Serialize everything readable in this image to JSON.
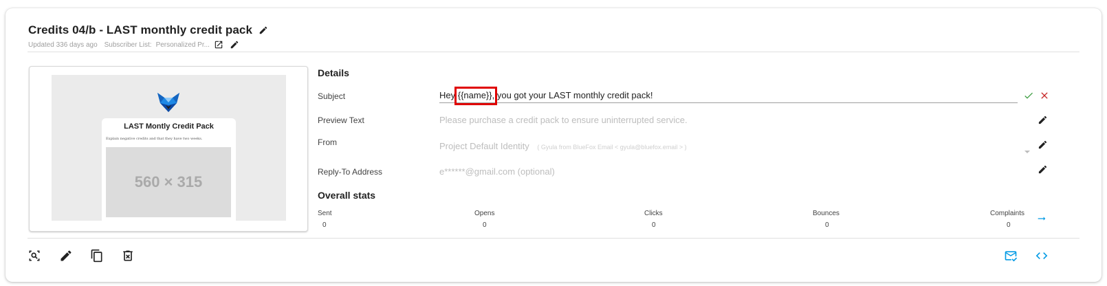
{
  "campaign": {
    "title": "Credits 04/b - LAST monthly credit pack",
    "updated": "Updated 336 days ago",
    "subscriber_list_label": "Subscriber List:",
    "subscriber_list_value": "Personalized Pr..."
  },
  "preview": {
    "heading": "LAST Montly Credit Pack",
    "body_text": "Explain negative credits and that they have two weeks.",
    "image_placeholder": "560 × 315"
  },
  "details": {
    "heading": "Details",
    "subject_label": "Subject",
    "subject_value": "Hey {{name}}, you got your LAST monthly credit pack!",
    "preview_text_label": "Preview Text",
    "preview_text_placeholder": "Please purchase a credit pack to ensure uninterrupted service.",
    "from_label": "From",
    "from_value": "Project Default Identity",
    "from_detail": "( Gyula from BlueFox Email < gyula@bluefox.email > )",
    "reply_to_label": "Reply-To Address",
    "reply_to_placeholder": "e******@gmail.com (optional)"
  },
  "stats": {
    "heading": "Overall stats",
    "items": [
      {
        "label": "Sent",
        "value": "0"
      },
      {
        "label": "Opens",
        "value": "0"
      },
      {
        "label": "Clicks",
        "value": "0"
      },
      {
        "label": "Bounces",
        "value": "0"
      },
      {
        "label": "Complaints",
        "value": "0"
      }
    ]
  },
  "colors": {
    "accent": "#039be5",
    "confirm": "#43a047",
    "cancel": "#c62828",
    "highlight": "#e00000",
    "logo_blue": "#1e88e5"
  },
  "icons": {
    "edit": "pencil-icon",
    "open_external": "open-in-new-icon",
    "confirm": "check-icon",
    "cancel": "close-icon",
    "stats_arrow": "arrow-right-icon",
    "preview_zoom": "zoom-icon",
    "duplicate": "copy-icon",
    "delete": "delete-icon",
    "send_test": "mail-check-icon",
    "code": "code-icon"
  }
}
